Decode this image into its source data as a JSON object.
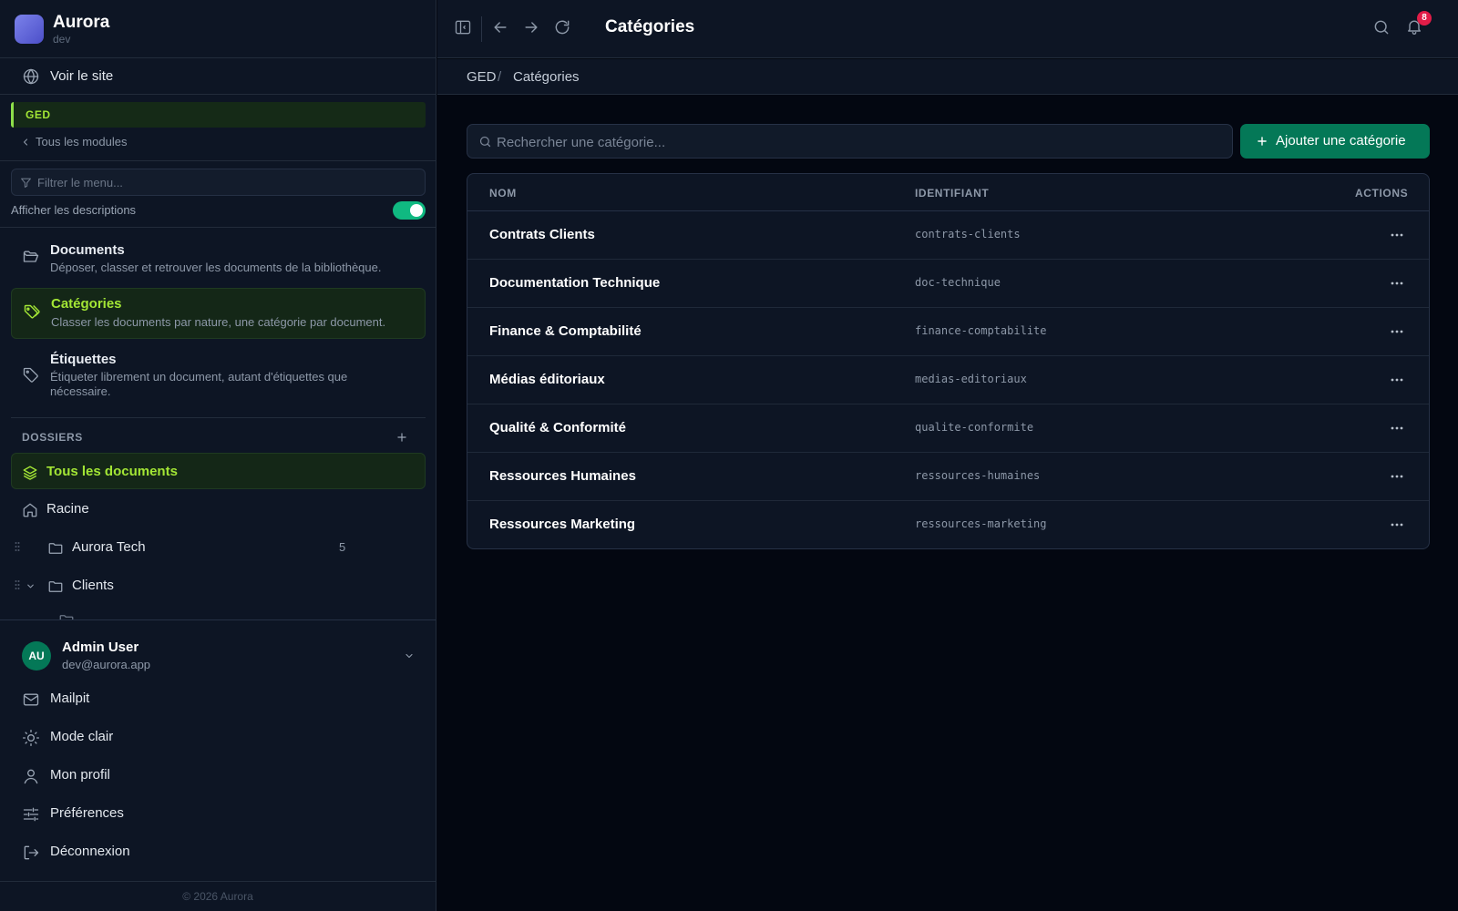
{
  "app": {
    "name": "Aurora",
    "env": "dev"
  },
  "sidebar": {
    "view_site": "Voir le site",
    "module": "GED",
    "back_modules": "Tous les modules",
    "filter_placeholder": "Filtrer le menu...",
    "show_descriptions": "Afficher les descriptions",
    "show_descriptions_on": true,
    "nav": [
      {
        "title": "Documents",
        "desc": "Déposer, classer et retrouver les documents de la bibliothèque.",
        "icon": "folder-open-icon"
      },
      {
        "title": "Catégories",
        "desc": "Classer les documents par nature, une catégorie par document.",
        "icon": "tags-icon",
        "active": true
      },
      {
        "title": "Étiquettes",
        "desc": "Étiqueter librement un document, autant d'étiquettes que nécessaire.",
        "icon": "tag-icon"
      }
    ],
    "folders_heading": "DOSSIERS",
    "tree": [
      {
        "label": "Tous les documents",
        "icon": "layers-icon",
        "active": true
      },
      {
        "label": "Racine",
        "icon": "home-icon"
      },
      {
        "label": "Aurora Tech",
        "icon": "folder-icon",
        "count": "5"
      },
      {
        "label": "Clients",
        "icon": "folder-icon"
      }
    ],
    "user": {
      "initials": "AU",
      "name": "Admin User",
      "email": "dev@aurora.app"
    },
    "footer": [
      {
        "label": "Mailpit",
        "icon": "mail-icon"
      },
      {
        "label": "Mode clair",
        "icon": "sun-icon"
      },
      {
        "label": "Mon profil",
        "icon": "user-icon"
      },
      {
        "label": "Préférences",
        "icon": "sliders-icon"
      },
      {
        "label": "Déconnexion",
        "icon": "logout-icon"
      }
    ],
    "copyright": "© 2026 Aurora"
  },
  "topbar": {
    "title": "Catégories",
    "notifications": "8"
  },
  "breadcrumb": [
    "GED",
    "Catégories"
  ],
  "search": {
    "placeholder": "Rechercher une catégorie..."
  },
  "add_button": "Ajouter une catégorie",
  "table": {
    "columns": [
      "NOM",
      "IDENTIFIANT",
      "ACTIONS"
    ],
    "rows": [
      {
        "name": "Contrats Clients",
        "slug": "contrats-clients"
      },
      {
        "name": "Documentation Technique",
        "slug": "doc-technique"
      },
      {
        "name": "Finance & Comptabilité",
        "slug": "finance-comptabilite"
      },
      {
        "name": "Médias éditoriaux",
        "slug": "medias-editoriaux"
      },
      {
        "name": "Qualité & Conformité",
        "slug": "qualite-conformite"
      },
      {
        "name": "Ressources Humaines",
        "slug": "ressources-humaines"
      },
      {
        "name": "Ressources Marketing",
        "slug": "ressources-marketing"
      }
    ]
  },
  "colors": {
    "accent": "#a3e635",
    "primary": "#047857",
    "toggle": "#10b981",
    "badge": "#e11d48"
  }
}
